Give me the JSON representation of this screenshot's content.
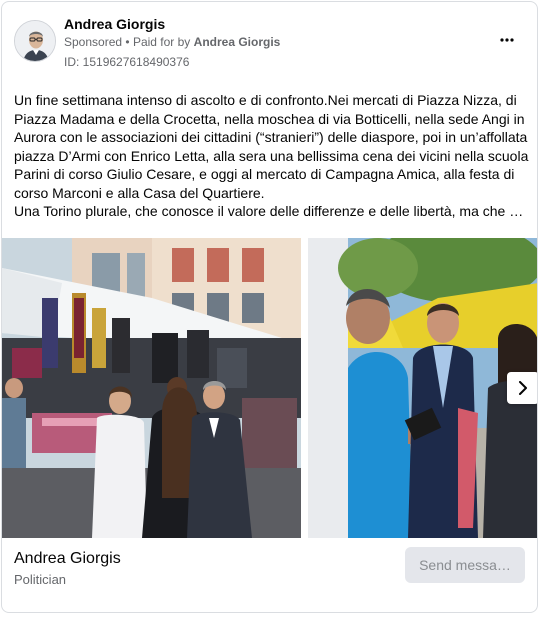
{
  "post": {
    "author": "Andrea Giorgis",
    "sponsored": "Sponsored",
    "paid_by_prefix": "Paid for by",
    "paid_by": "Andrea Giorgis",
    "id_line": "ID: 1519627618490376",
    "more_icon": "more-dots-icon"
  },
  "body": {
    "paragraph1": "Un fine settimana intenso di ascolto e di confronto.Nei mercati di Piazza Nizza, di Piazza Madama e della Crocetta, nella moschea di via Botticelli, nella sede Angi in Aurora con le associazioni dei cittadini (“stranieri”) delle diaspore, poi in un’affollata piazza D’Armi con Enrico Letta, alla sera una bellissima cena dei vicini nella scuola Parini di corso Giulio Cesare, e oggi al mercato di Campagna Amica, alla festa di corso Marconi e alla Casa del Quartiere.",
    "paragraph2": "Una Torino plurale, che conosce il valore delle differenze e delle libertà, ma che h…"
  },
  "carousel": {
    "next_icon": "chevron-right-icon"
  },
  "footer": {
    "page_name": "Andrea Giorgis",
    "category": "Politician",
    "send_label": "Send messa…"
  },
  "colors": {
    "secondary_text": "#65676b",
    "button_bg": "#e4e6eb",
    "border": "#dadde1"
  }
}
